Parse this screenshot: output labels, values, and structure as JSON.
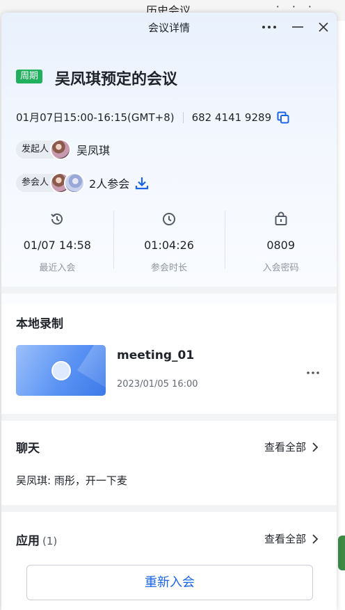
{
  "background_window": {
    "title": "历史会议"
  },
  "window": {
    "title": "会议详情"
  },
  "meeting": {
    "badge": "周期",
    "title": "吴凤琪预定的会议",
    "time": "01月07日15:00-16:15(GMT+8)",
    "meeting_id": "682 4141 9289"
  },
  "host": {
    "label": "发起人",
    "name": "吴凤琪"
  },
  "participants": {
    "label": "参会人",
    "summary": "2人参会"
  },
  "stats": [
    {
      "icon": "history-clock-icon",
      "value": "01/07 14:58",
      "label": "最近入会"
    },
    {
      "icon": "clock-icon",
      "value": "01:04:26",
      "label": "参会时长"
    },
    {
      "icon": "lock-bag-icon",
      "value": "0809",
      "label": "入会密码"
    }
  ],
  "local_recording": {
    "title": "本地录制",
    "file_name": "meeting_01",
    "date": "2023/01/05 16:00"
  },
  "chat": {
    "title": "聊天",
    "see_all": "查看全部",
    "last_message": "吴凤琪: 雨彤，开一下麦"
  },
  "apps": {
    "title": "应用",
    "count": "(1)",
    "see_all": "查看全部"
  },
  "footer": {
    "rejoin_label": "重新入会"
  },
  "colors": {
    "accent": "#1a64e8",
    "badge": "#20b05e"
  }
}
